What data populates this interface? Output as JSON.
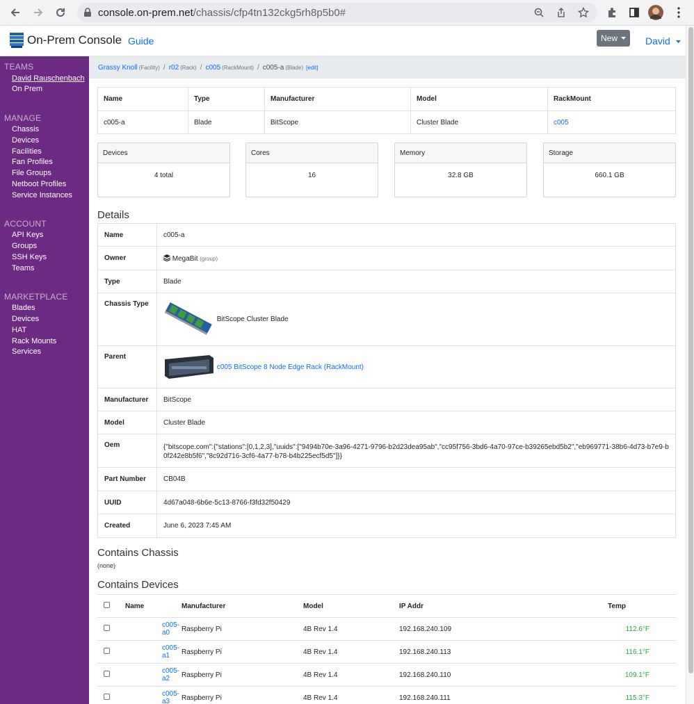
{
  "browser": {
    "url_host": "console.on-prem.net",
    "url_path": "/chassis/cfp4tn132ckg5rh8p5b0#"
  },
  "navbar": {
    "brand": "On-Prem Console",
    "guide": "Guide",
    "new_button": "New",
    "user": "David"
  },
  "sidebar": {
    "teams_heading": "TEAMS",
    "teams": [
      "David Rauschenbach",
      "On Prem"
    ],
    "manage_heading": "MANAGE",
    "manage": [
      "Chassis",
      "Devices",
      "Facilities",
      "Fan Profiles",
      "File Groups",
      "Netboot Profiles",
      "Service Instances"
    ],
    "account_heading": "ACCOUNT",
    "account": [
      "API Keys",
      "Groups",
      "SSH Keys",
      "Teams"
    ],
    "marketplace_heading": "MARKETPLACE",
    "marketplace": [
      "Blades",
      "Devices",
      "HAT",
      "Rack Mounts",
      "Services"
    ]
  },
  "breadcrumb": {
    "facility": "Grassy Knoll",
    "facility_type": "(Facility)",
    "rack": "r02",
    "rack_type": "(Rack)",
    "rackmount": "c005",
    "rackmount_type": "(RackMount)",
    "current": "c005-a",
    "current_type": "(Blade)",
    "edit": "[edit]",
    "sep": "/"
  },
  "summary_table": {
    "headers": [
      "Name",
      "Type",
      "Manufacturer",
      "Model",
      "RackMount"
    ],
    "row": [
      "c005-a",
      "Blade",
      "BitScope",
      "Cluster Blade",
      "c005"
    ]
  },
  "cards": [
    {
      "title": "Devices",
      "value": "4 total"
    },
    {
      "title": "Cores",
      "value": "16"
    },
    {
      "title": "Memory",
      "value": "32.8 GB"
    },
    {
      "title": "Storage",
      "value": "660.1 GB"
    }
  ],
  "details": {
    "title": "Details",
    "name_label": "Name",
    "name": "c005-a",
    "owner_label": "Owner",
    "owner": "MegaBit",
    "owner_type": "(group)",
    "type_label": "Type",
    "type": "Blade",
    "chassis_type_label": "Chassis Type",
    "chassis_type": "BitScope Cluster Blade",
    "parent_label": "Parent",
    "parent": "c005 BitScope 8 Node Edge Rack (RackMount)",
    "manufacturer_label": "Manufacturer",
    "manufacturer": "BitScope",
    "model_label": "Model",
    "model": "Cluster Blade",
    "oem_label": "Oem",
    "oem": "{\"bitscope.com\":{\"stations\":[0,1,2,3],\"uuids\":[\"9494b70e-3a96-4271-9796-b2d23dea95ab\",\"cc95f756-3bd6-4a70-97ce-b39265ebd5b2\",\"eb969771-38b6-4d73-b7e9-b0f242e8b5f6\",\"8c92d716-3cf6-4a77-b78-b4b225ecf5d5\"]}}",
    "part_number_label": "Part Number",
    "part_number": "CB04B",
    "uuid_label": "UUID",
    "uuid": "4d67a048-6b6e-5c13-8766-f3fd32f50429",
    "created_label": "Created",
    "created": "June 6, 2023 7:45 AM"
  },
  "contains_chassis": {
    "title": "Contains Chassis",
    "value": "(none)"
  },
  "contains_devices": {
    "title": "Contains Devices",
    "headers": [
      "Name",
      "Manufacturer",
      "Model",
      "IP Addr",
      "Temp"
    ],
    "rows": [
      {
        "name": "c005-a0",
        "manufacturer": "Raspberry Pi",
        "model": "4B Rev 1.4",
        "ip": "192.168.240.109",
        "temp": "112.6°F"
      },
      {
        "name": "c005-a1",
        "manufacturer": "Raspberry Pi",
        "model": "4B Rev 1.4",
        "ip": "192.168.240.113",
        "temp": "116.1°F"
      },
      {
        "name": "c005-a2",
        "manufacturer": "Raspberry Pi",
        "model": "4B Rev 1.4",
        "ip": "192.168.240.110",
        "temp": "109.1°F"
      },
      {
        "name": "c005-a3",
        "manufacturer": "Raspberry Pi",
        "model": "4B Rev 1.4",
        "ip": "192.168.240.111",
        "temp": "115.3°F"
      }
    ]
  },
  "colors": {
    "sidebar": "#6c2b82",
    "link": "#0d6efd",
    "temp_ok": "#28a745"
  },
  "icons": [
    "back-icon",
    "forward-icon",
    "reload-icon",
    "lock-icon",
    "zoom-icon",
    "share-icon",
    "star-icon",
    "extensions-icon",
    "sidepanel-icon",
    "profile-avatar",
    "menu-dots-icon",
    "server-logo-icon",
    "layers-icon",
    "caret-down-icon"
  ]
}
